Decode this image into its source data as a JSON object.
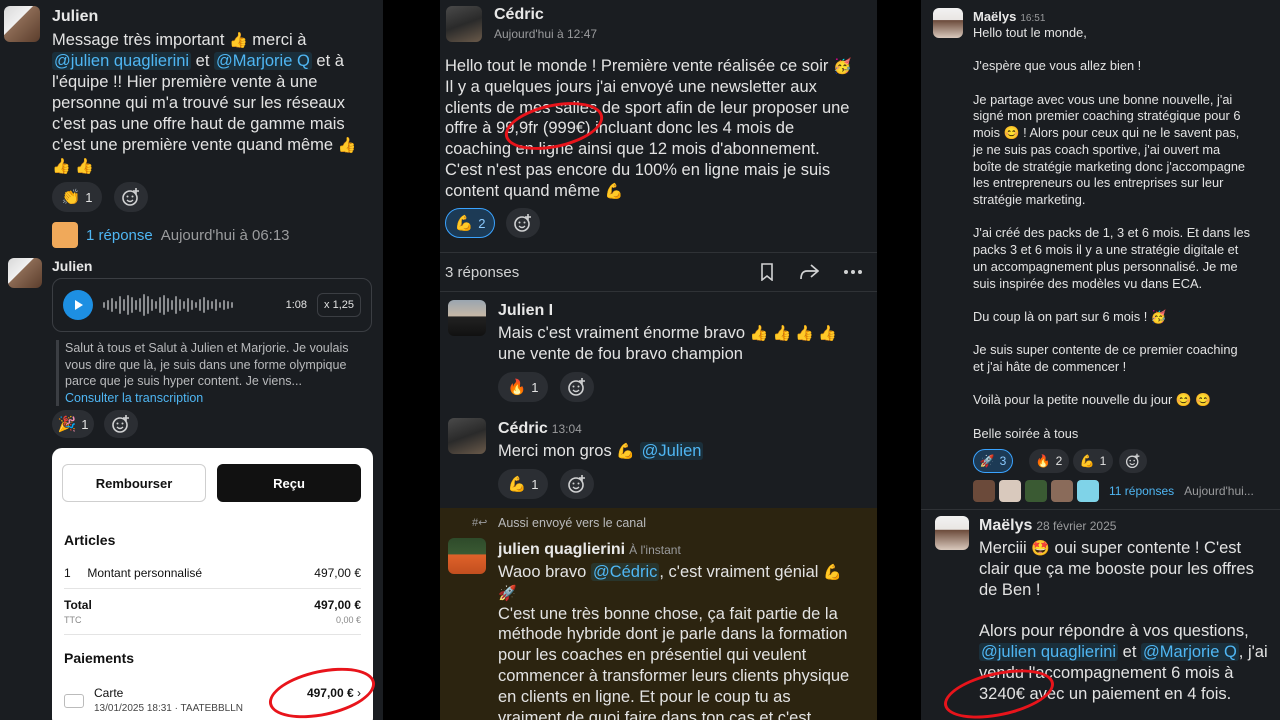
{
  "panel1": {
    "msg1": {
      "author": "Julien",
      "lines": [
        "Message très important",
        "merci à",
        "@julien quaglierini",
        "et",
        "@Marjorie Q",
        "et à",
        "l'équipe !! Hier première vente à une",
        "personne qui m'a trouvé sur les réseaux",
        "c'est pas une offre haut de gamme mais",
        "c'est une première vente quand même"
      ],
      "reaction_emoji": "👏",
      "reaction_count": "1",
      "reply_label": "1 réponse",
      "reply_time": "Aujourd'hui à 06:13"
    },
    "msg2": {
      "author": "Julien",
      "audio_duration": "1:08",
      "audio_speed": "x 1,25",
      "transcript": "Salut à tous et Salut à Julien et Marjorie. Je voulais vous dire que là, je suis dans une forme olympique parce que je suis hyper content. Je viens...",
      "transcript_link": "Consulter la transcription",
      "reaction_emoji": "🎉",
      "reaction_count": "1"
    },
    "receipt": {
      "refund_label": "Rembourser",
      "receipt_label": "Reçu",
      "articles_title": "Articles",
      "item_qty": "1",
      "item_name": "Montant personnalisé",
      "item_price": "497,00 €",
      "total_label": "Total",
      "total_sub": "TTC",
      "total_value": "497,00 €",
      "total_tax": "0,00 €",
      "payments_title": "Paiements",
      "payment_method": "Carte",
      "payment_date": "13/01/2025 18:31 · TAATEBBLLN",
      "payment_value": "497,00 €"
    }
  },
  "panel2": {
    "msg1": {
      "author": "Cédric",
      "time": "Aujourd'hui à 12:47",
      "lines": [
        "Hello tout le monde ! Première vente réalisée ce soir",
        "Il y a quelques jours j'ai envoyé une newsletter aux",
        "clients de mes salles de sport afin de leur proposer une",
        "offre à 99,9fr (999€) incluant donc les 4 mois de",
        "coaching en ligne ainsi que 12 mois d'abonnement.",
        "C'est n'est pas encore du 100% en ligne mais je suis",
        "content quand même"
      ],
      "reaction_emoji": "💪",
      "reaction_count": "2"
    },
    "thread_label": "3 réponses",
    "reply1": {
      "author": "Julien I",
      "lines": [
        "Mais c'est vraiment énorme bravo",
        "une vente de fou bravo champion"
      ],
      "reaction_emoji": "🔥",
      "reaction_count": "1"
    },
    "reply2": {
      "author": "Cédric",
      "time": "13:04",
      "text": "Merci mon gros",
      "mention": "@Julien",
      "reaction_emoji": "💪",
      "reaction_count": "1"
    },
    "reply3": {
      "sent_to": "Aussi envoyé vers le canal",
      "author": "julien quaglierini",
      "time": "À l'instant",
      "line1_pre": "Waoo bravo",
      "mention": "@Cédric",
      "line1_post": ", c'est vraiment génial",
      "lines": [
        "C'est une très bonne chose, ça fait partie de la",
        "méthode hybride dont je parle dans la formation",
        "pour les coaches en présentiel qui veulent",
        "commencer à transformer leurs clients physique",
        "en clients en ligne. Et pour le coup tu as",
        "vraiment de quoi faire dans ton cas et c'est"
      ]
    }
  },
  "panel3": {
    "msg1": {
      "author": "Maëlys",
      "time": "16:51",
      "paragraphs": [
        [
          "Hello tout le monde,"
        ],
        [
          "J'espère que vous allez bien !"
        ],
        [
          "Je partage avec vous une bonne nouvelle, j'ai",
          "signé mon premier coaching stratégique pour 6",
          "mois 😊 ! Alors pour ceux qui ne le savent pas,",
          "je ne suis pas coach sportive, j'ai ouvert ma",
          "boîte de stratégie marketing donc j'accompagne",
          "les entrepreneurs ou les entreprises sur leur",
          "stratégie marketing."
        ],
        [
          "J'ai créé des packs de 1, 3 et 6 mois. Et dans les",
          "packs 3 et 6 mois il y a une stratégie digitale et",
          "un accompagnement plus personnalisé. Je me",
          "suis inspirée des modèles vu dans ECA."
        ],
        [
          "Du coup là on part sur 6 mois ! 🥳"
        ],
        [
          "Je suis super contente de ce premier coaching",
          "et j'ai hâte de commencer !"
        ],
        [
          "Voilà pour la petite nouvelle du jour 😊 😊"
        ],
        [
          "Belle soirée à tous"
        ]
      ],
      "reactions": [
        {
          "emoji": "🚀",
          "count": "3"
        },
        {
          "emoji": "🔥",
          "count": "2"
        },
        {
          "emoji": "💪",
          "count": "1"
        }
      ],
      "replies_label": "11 réponses",
      "replies_time": "Aujourd'hui..."
    },
    "msg2": {
      "author": "Maëlys",
      "time": "28 février 2025",
      "line1": "Merciii",
      "line1_post": "oui super contente ! C'est",
      "line2": "clair que ça me booste pour les offres",
      "line3": "de Ben !",
      "line4": "Alors pour répondre à vos questions,",
      "mention1": "@julien quaglierini",
      "and": "et",
      "mention2": "@Marjorie Q",
      "line5_post": ", j'ai",
      "line6": "vendu l'accompagnement 6 mois à",
      "line7": "3240€ avec un paiement en 4 fois."
    }
  },
  "colors": {
    "bg": "#1a1d21",
    "mention": "#4fb6f3",
    "annotation": "#e8141b",
    "highlight": "#2c2410"
  }
}
